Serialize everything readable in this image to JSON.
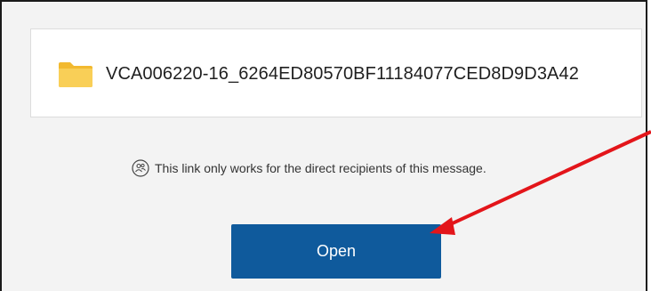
{
  "file": {
    "name": "VCA006220-16_6264ED80570BF11184077CED8D9D3A42",
    "icon": "folder-icon"
  },
  "notice": {
    "icon": "people-circle-icon",
    "text": "This link only works for the direct recipients of this message."
  },
  "open_button": {
    "label": "Open"
  },
  "colors": {
    "button": "#0f5a9c",
    "folder": "#f7c948",
    "arrow": "#e3151a"
  }
}
